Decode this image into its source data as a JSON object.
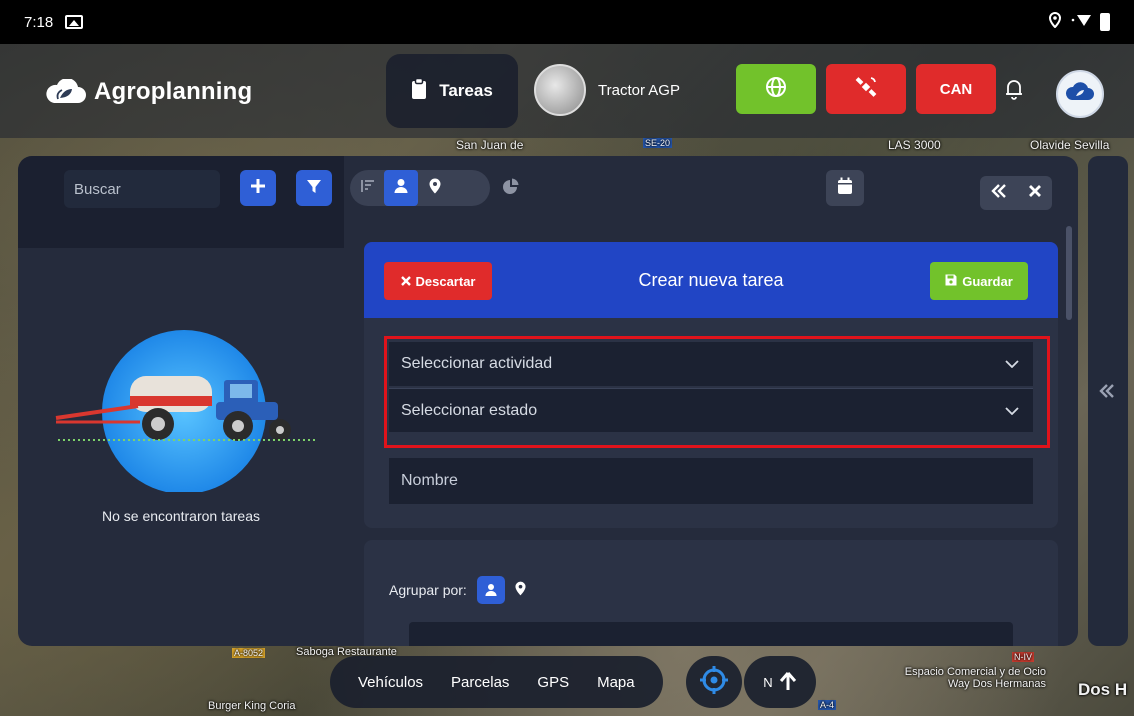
{
  "status_bar": {
    "time": "7:18"
  },
  "app": {
    "name": "Agroplanning"
  },
  "header": {
    "section_label": "Tareas",
    "vehicle_label": "Tractor AGP",
    "can_label": "CAN",
    "colors": {
      "green": "#72c22b",
      "red": "#e02b2b",
      "blue": "#2f5fd6"
    }
  },
  "map": {
    "labels": [
      "San Juan de",
      "LAS 3000",
      "Olavide Sevilla",
      "Saboga Restaurante",
      "A-8052",
      "Burger King Coria",
      "Espacio Comercial y de Ocio Way Dos Hermanas",
      "Dos H",
      "A-4",
      "N-IV",
      "SE-20"
    ]
  },
  "toolbar": {
    "search_placeholder": "Buscar",
    "icons": [
      "plus-icon",
      "filter-icon",
      "sort-icon",
      "user-icon",
      "location-pin-icon",
      "pie-chart-icon",
      "calendar-icon",
      "double-chevron-left-icon",
      "close-icon"
    ]
  },
  "tasks": {
    "empty_message": "No se encontraron tareas"
  },
  "form": {
    "title": "Crear nueva tarea",
    "discard_label": "Descartar",
    "save_label": "Guardar",
    "activity_placeholder": "Seleccionar actividad",
    "state_placeholder": "Seleccionar estado",
    "name_placeholder": "Nombre",
    "group_by_label": "Agrupar por:"
  },
  "bottom_nav": {
    "items": [
      "Vehículos",
      "Parcelas",
      "GPS",
      "Mapa"
    ],
    "north_label": "N"
  }
}
